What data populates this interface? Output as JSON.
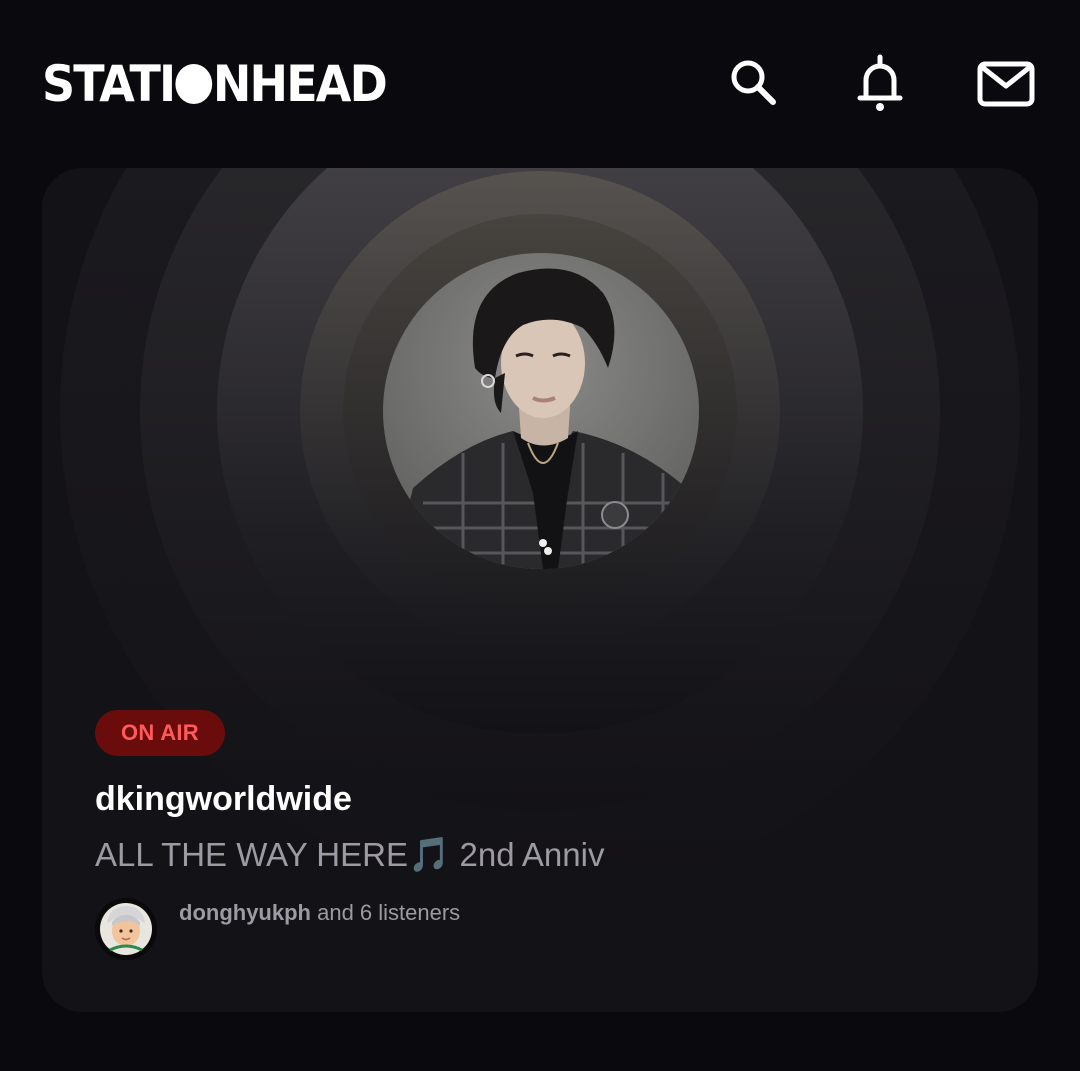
{
  "app": {
    "logo_left": "STATI",
    "logo_right": "NHEAD"
  },
  "header_icons": [
    "search-icon",
    "bell-icon",
    "mail-icon"
  ],
  "station": {
    "status_badge": "ON AIR",
    "name": "dkingworldwide",
    "title_text": "ALL THE WAY HERE",
    "title_emoji": "🎵",
    "title_suffix": " 2nd Anniv",
    "host": "donghyukph",
    "listeners_suffix": " and 6 listeners"
  },
  "colors": {
    "background": "#0a090d",
    "card": "#131217",
    "on_air_bg": "#6b0c0c",
    "on_air_text": "#ff5a5a",
    "muted_text": "#9c9aa2"
  }
}
